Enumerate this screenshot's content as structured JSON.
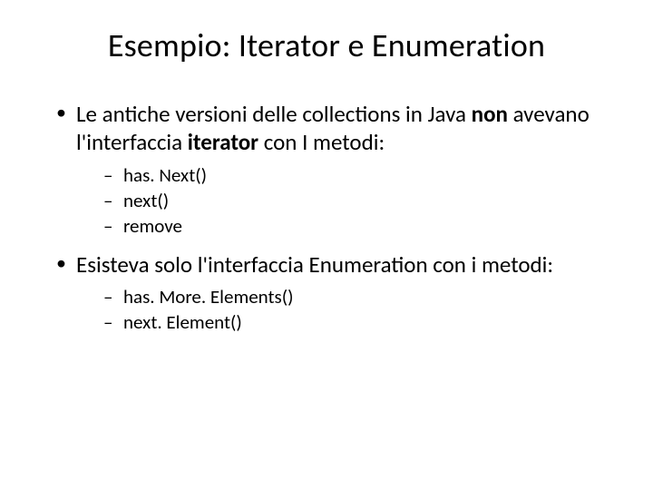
{
  "title": "Esempio: Iterator e Enumeration",
  "bullets": [
    {
      "pre": "Le antiche versioni delle collections in Java ",
      "bold1": "non",
      "mid": " avevano l'interfaccia ",
      "bold2": "iterator",
      "post": " con I metodi:",
      "sub": [
        "has. Next()",
        "next()",
        "remove"
      ]
    },
    {
      "pre": "Esisteva solo l'interfaccia Enumeration con i metodi:",
      "bold1": "",
      "mid": "",
      "bold2": "",
      "post": "",
      "sub": [
        "has. More. Elements()",
        "next. Element()"
      ]
    }
  ]
}
